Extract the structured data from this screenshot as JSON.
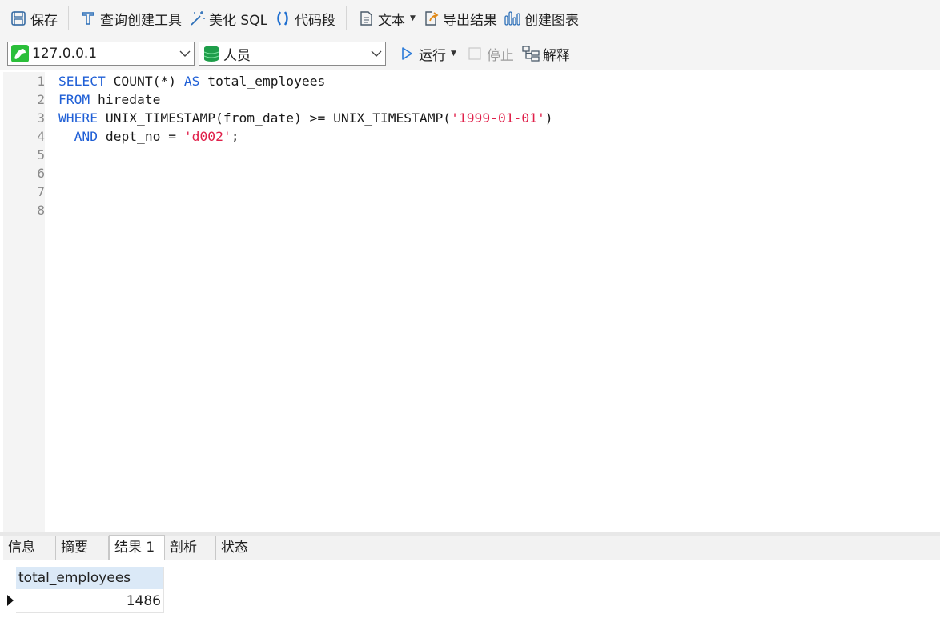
{
  "toolbar": {
    "save_label": "保存",
    "query_builder_label": "查询创建工具",
    "beautify_label": "美化 SQL",
    "snippet_label": "代码段",
    "text_label": "文本",
    "export_label": "导出结果",
    "chart_label": "创建图表"
  },
  "connection": {
    "host_value": "127.0.0.1",
    "database_value": "人员"
  },
  "run_toolbar": {
    "run_label": "运行",
    "stop_label": "停止",
    "explain_label": "解释"
  },
  "editor": {
    "line_numbers": [
      "1",
      "2",
      "3",
      "4",
      "5",
      "6",
      "7",
      "8"
    ],
    "lines": [
      [
        {
          "t": "SELECT",
          "c": "kw"
        },
        {
          "t": " COUNT(*) "
        },
        {
          "t": "AS",
          "c": "kw"
        },
        {
          "t": " total_employees"
        }
      ],
      [
        {
          "t": "FROM",
          "c": "kw"
        },
        {
          "t": " hiredate"
        }
      ],
      [
        {
          "t": "WHERE",
          "c": "kw"
        },
        {
          "t": " UNIX_TIMESTAMP(from_date) >= UNIX_TIMESTAMP("
        },
        {
          "t": "'1999-01-01'",
          "c": "str"
        },
        {
          "t": ")"
        }
      ],
      [
        {
          "t": "  "
        },
        {
          "t": "AND",
          "c": "kw"
        },
        {
          "t": " dept_no = "
        },
        {
          "t": "'d002'",
          "c": "str"
        },
        {
          "t": ";"
        }
      ],
      [],
      [],
      [],
      []
    ]
  },
  "result_tabs": {
    "info": "信息",
    "summary": "摘要",
    "result1": "结果 1",
    "profile": "剖析",
    "status": "状态",
    "active": "result1"
  },
  "result_grid": {
    "column": "total_employees",
    "value": "1486"
  },
  "colors": {
    "keyword": "#1f5fd6",
    "string": "#e0204a",
    "header_bg": "#dbe9f7"
  }
}
